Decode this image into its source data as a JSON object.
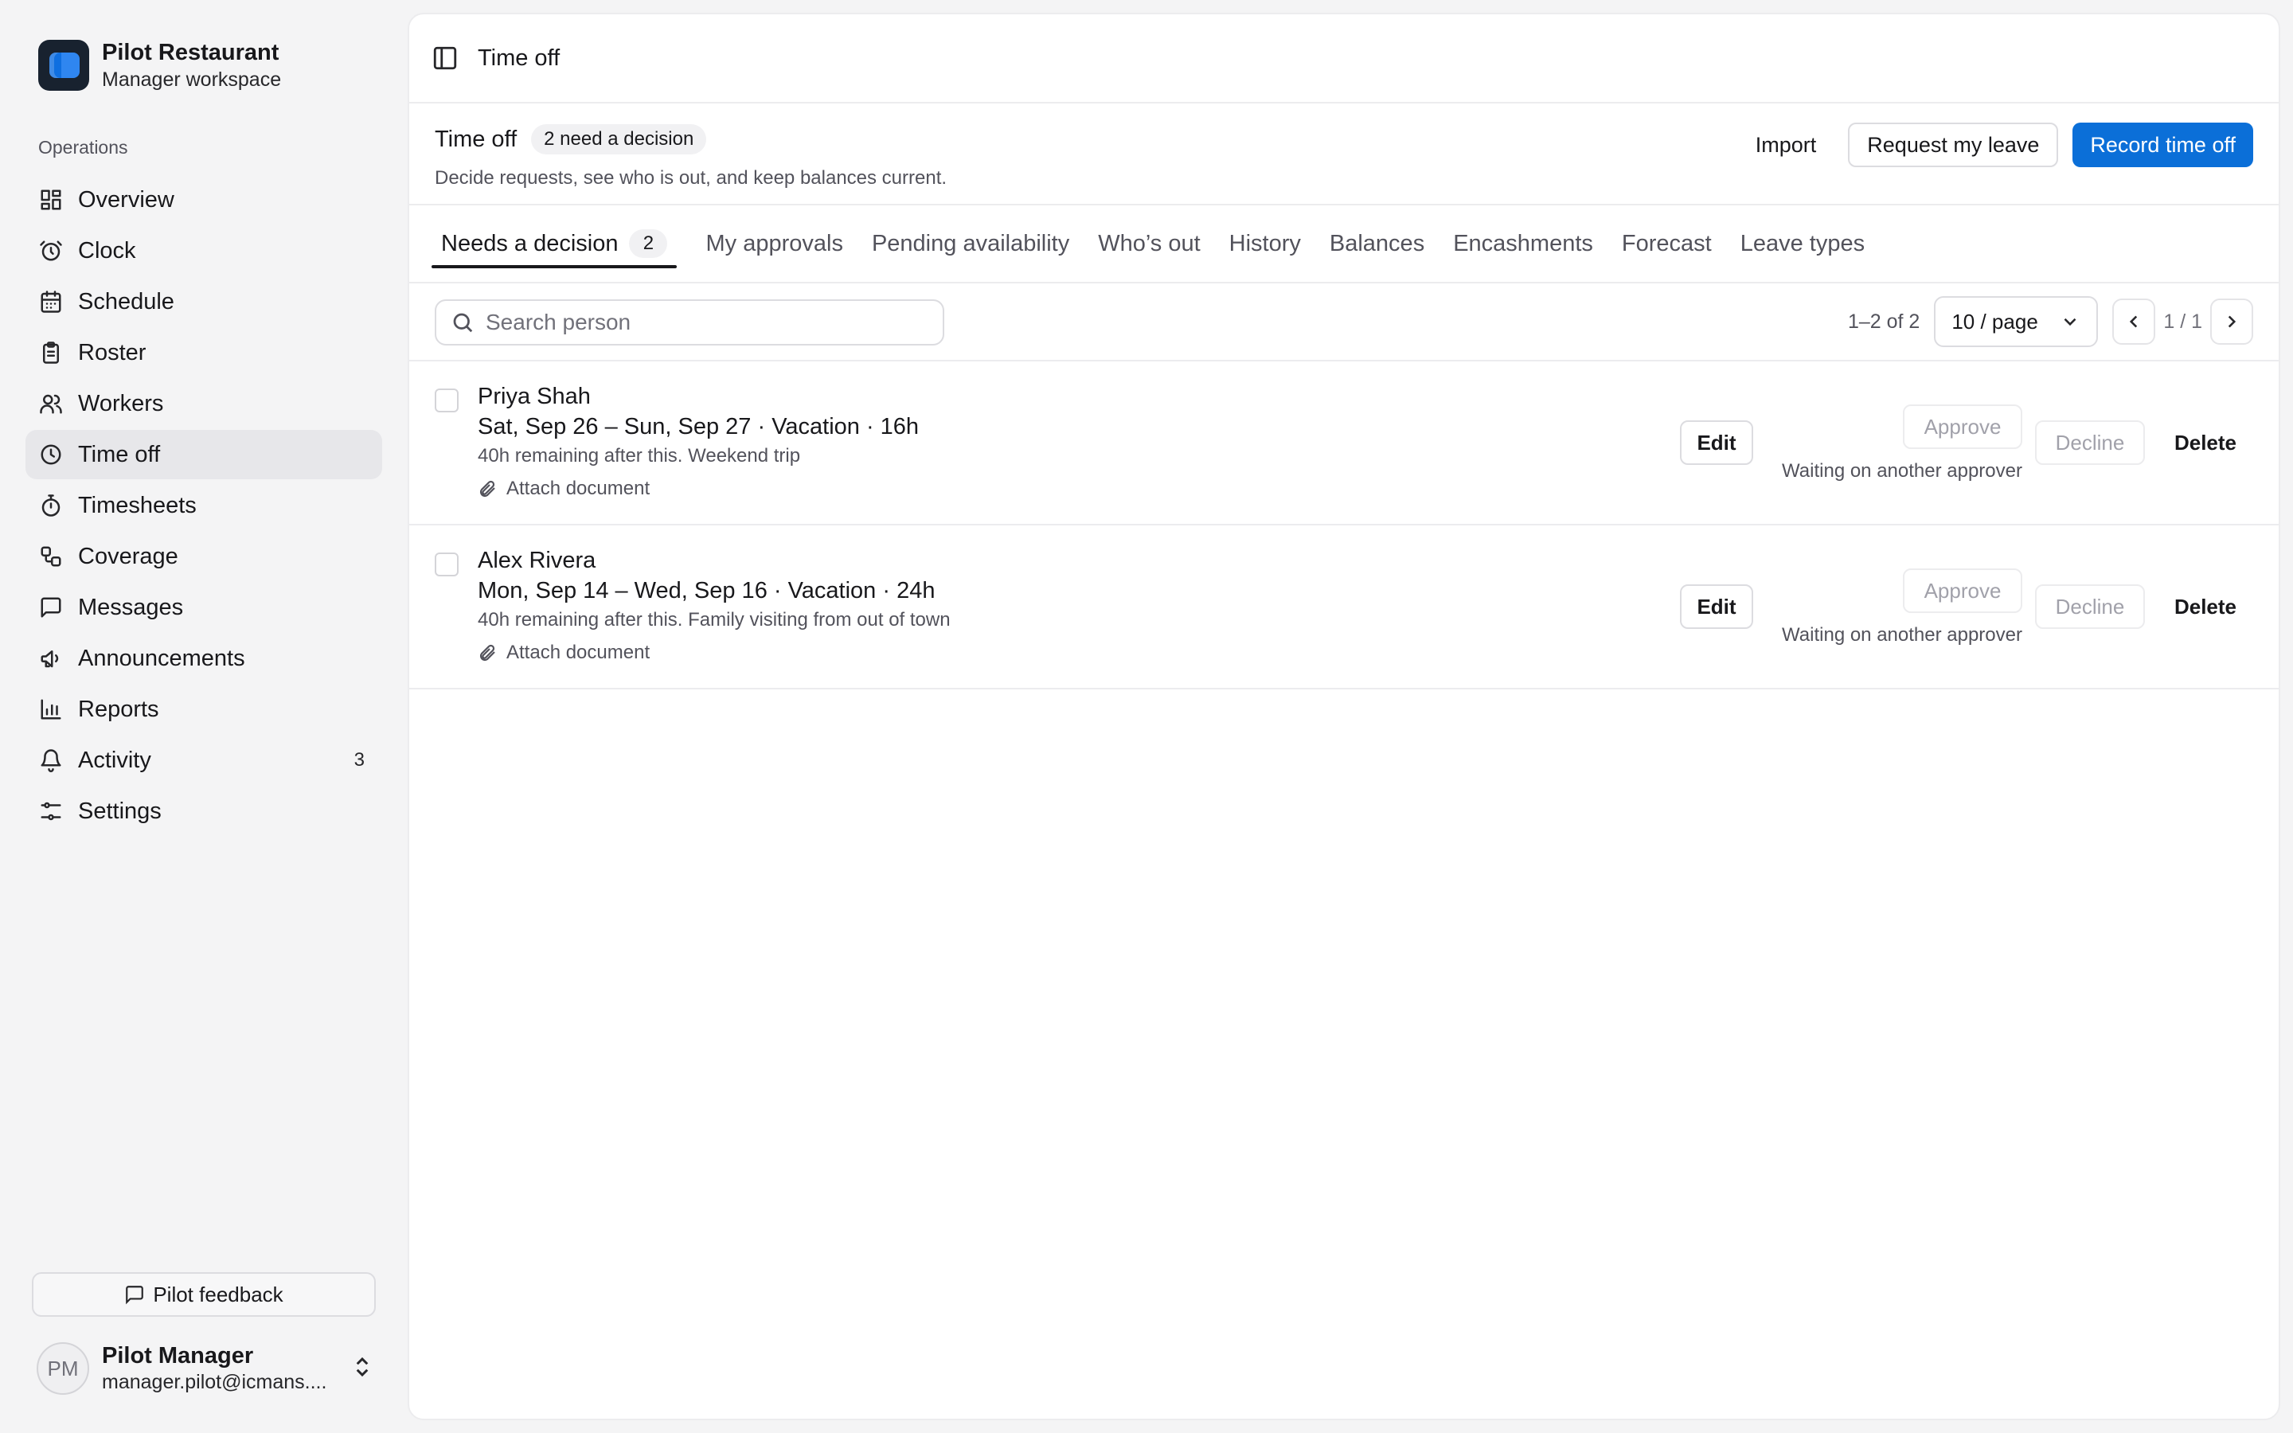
{
  "brand": {
    "name": "Pilot Restaurant",
    "subtitle": "Manager workspace"
  },
  "sidebar": {
    "section_label": "Operations",
    "items": [
      {
        "label": "Overview",
        "icon": "grid-icon"
      },
      {
        "label": "Clock",
        "icon": "alarm-clock-icon"
      },
      {
        "label": "Schedule",
        "icon": "calendar-icon"
      },
      {
        "label": "Roster",
        "icon": "clipboard-icon"
      },
      {
        "label": "Workers",
        "icon": "users-icon"
      },
      {
        "label": "Time off",
        "icon": "clock-icon",
        "active": true
      },
      {
        "label": "Timesheets",
        "icon": "stopwatch-icon"
      },
      {
        "label": "Coverage",
        "icon": "coverage-icon"
      },
      {
        "label": "Messages",
        "icon": "message-icon"
      },
      {
        "label": "Announcements",
        "icon": "megaphone-icon"
      },
      {
        "label": "Reports",
        "icon": "bar-chart-icon"
      },
      {
        "label": "Activity",
        "icon": "bell-icon",
        "badge": "3"
      },
      {
        "label": "Settings",
        "icon": "sliders-icon"
      }
    ],
    "feedback_label": "Pilot feedback",
    "user": {
      "initials": "PM",
      "name": "Pilot Manager",
      "email": "manager.pilot@icmans...."
    }
  },
  "topbar": {
    "title": "Time off"
  },
  "header": {
    "title": "Time off",
    "pill": "2 need a decision",
    "subtitle": "Decide requests, see who is out, and keep balances current.",
    "actions": {
      "import": "Import",
      "request": "Request my leave",
      "record": "Record time off"
    }
  },
  "tabs": [
    {
      "label": "Needs a decision",
      "count": "2",
      "active": true
    },
    {
      "label": "My approvals"
    },
    {
      "label": "Pending availability"
    },
    {
      "label": "Who’s out"
    },
    {
      "label": "History"
    },
    {
      "label": "Balances"
    },
    {
      "label": "Encashments"
    },
    {
      "label": "Forecast"
    },
    {
      "label": "Leave types"
    }
  ],
  "toolbar": {
    "search_placeholder": "Search person",
    "range": "1–2 of 2",
    "page_size": "10 / page",
    "page": "1 / 1"
  },
  "requests": [
    {
      "name": "Priya Shah",
      "dates": "Sat, Sep 26 – Sun, Sep 27 · Vacation · 16h",
      "note": "40h remaining after this. Weekend trip",
      "attach": "Attach document",
      "edit": "Edit",
      "approve": "Approve",
      "waiting": "Waiting on another approver",
      "decline": "Decline",
      "delete": "Delete"
    },
    {
      "name": "Alex Rivera",
      "dates": "Mon, Sep 14 – Wed, Sep 16 · Vacation · 24h",
      "note": "40h remaining after this. Family visiting from out of town",
      "attach": "Attach document",
      "edit": "Edit",
      "approve": "Approve",
      "waiting": "Waiting on another approver",
      "decline": "Decline",
      "delete": "Delete"
    }
  ],
  "colors": {
    "primary": "#0b6fd8",
    "active_nav": "#e7e7ea",
    "border": "#ececee"
  }
}
